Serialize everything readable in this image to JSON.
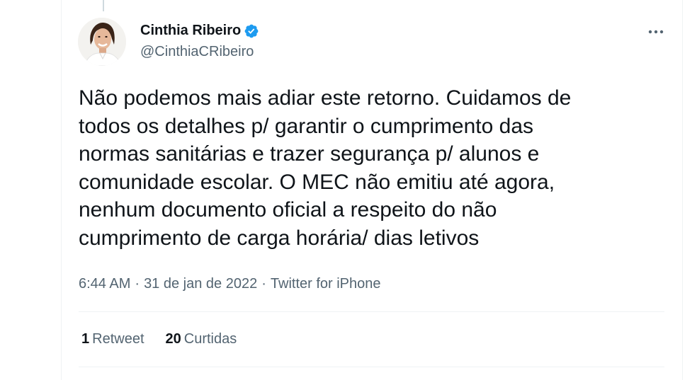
{
  "tweet": {
    "author": {
      "display_name": "Cinthia Ribeiro",
      "handle": "@CinthiaCRibeiro",
      "verified": true,
      "verified_icon": "verified-badge-icon"
    },
    "text": "Não podemos mais adiar este retorno. Cuidamos de\ntodos os detalhes p/ garantir o cumprimento das\nnormas sanitárias e trazer segurança p/ alunos e\ncomunidade escolar. O MEC não emitiu até agora,\nnenhum documento oficial a respeito do não\ncumprimento de carga horária/ dias letivos",
    "meta": {
      "time": "6:44 AM",
      "sep1": "·",
      "date": "31 de jan de 2022",
      "sep2": "·",
      "source": "Twitter for iPhone"
    },
    "stats": {
      "retweets_count": "1",
      "retweets_label": "Retweet",
      "likes_count": "20",
      "likes_label": "Curtidas"
    },
    "more_icon": "more-options-icon"
  },
  "colors": {
    "text_primary": "#0f1419",
    "text_secondary": "#536471",
    "verified_blue": "#1d9bf0",
    "border": "#eff3f4"
  }
}
